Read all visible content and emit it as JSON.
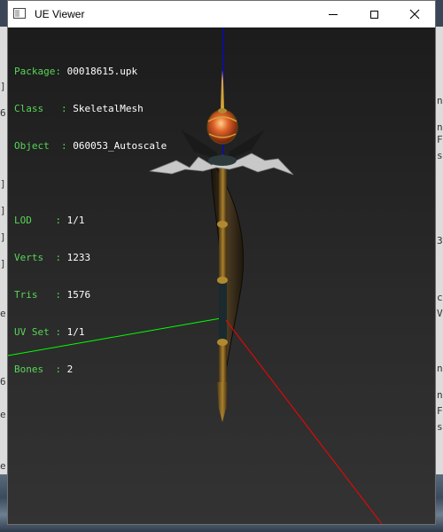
{
  "window": {
    "title": "UE Viewer",
    "controls": {
      "minimize": "minimize",
      "maximize": "maximize",
      "close": "close"
    }
  },
  "info": {
    "package": {
      "label": "Package: ",
      "value": "00018615.upk"
    },
    "class": {
      "label": "Class   : ",
      "value": "SkeletalMesh"
    },
    "object": {
      "label": "Object  : ",
      "value": "060053_Autoscale"
    },
    "lod": {
      "label": "LOD    : ",
      "value": "1/1"
    },
    "verts": {
      "label": "Verts  : ",
      "value": "1233"
    },
    "tris": {
      "label": "Tris   : ",
      "value": "1576"
    },
    "uvset": {
      "label": "UV Set : ",
      "value": "1/1"
    },
    "bones": {
      "label": "Bones  : ",
      "value": "2"
    }
  },
  "axes": {
    "x_color": "#ff0000",
    "y_color": "#00ff00",
    "z_color": "#0000ff"
  },
  "icons": {
    "app": "window-icon",
    "close": "close-icon",
    "maximize": "maximize-icon",
    "minimize": "minimize-icon"
  }
}
